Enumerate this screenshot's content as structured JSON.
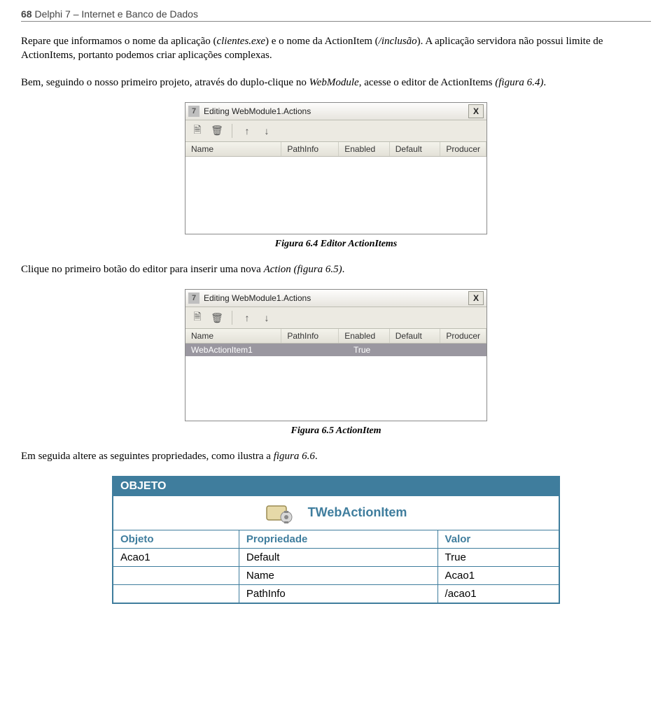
{
  "header": {
    "page_number": "68",
    "book_title": "Delphi 7 – Internet e Banco de Dados"
  },
  "para1_a": "Repare que informamos o nome da aplicação (",
  "para1_b": "clientes.exe",
  "para1_c": ") e o nome da ActionItem (",
  "para1_d": "/inclusão",
  "para1_e": "). A aplicação servidora não possui limite de ActionItems, portanto podemos criar aplicações complexas.",
  "para2_a": "Bem, seguindo o nosso primeiro projeto, através do duplo-clique no ",
  "para2_b": "WebModule",
  "para2_c": ", acesse o editor de ActionItems ",
  "para2_d": "(figura 6.4)",
  "para2_e": ".",
  "fig1": {
    "title": "Editing WebModule1.Actions",
    "columns": {
      "c1": "Name",
      "c2": "PathInfo",
      "c3": "Enabled",
      "c4": "Default",
      "c5": "Producer"
    },
    "caption": "Figura 6.4 Editor ActionItems"
  },
  "para3_a": "Clique no primeiro botão do editor para inserir uma nova ",
  "para3_b": "Action (figura 6.5)",
  "para3_c": ".",
  "fig2": {
    "title": "Editing WebModule1.Actions",
    "columns": {
      "c1": "Name",
      "c2": "PathInfo",
      "c3": "Enabled",
      "c4": "Default",
      "c5": "Producer"
    },
    "row": {
      "name": "WebActionItem1",
      "enabled": "True"
    },
    "caption": "Figura 6.5 ActionItem"
  },
  "para4_a": "Em seguida altere as seguintes propriedades, como ilustra a ",
  "para4_b": "figura 6.6",
  "para4_c": ".",
  "table": {
    "head": "OBJETO",
    "class_name": "TWebActionItem",
    "cols": {
      "c1": "Objeto",
      "c2": "Propriedade",
      "c3": "Valor"
    },
    "rows": [
      {
        "obj": "Acao1",
        "prop": "Default",
        "val": "True"
      },
      {
        "obj": "",
        "prop": "Name",
        "val": "Acao1"
      },
      {
        "obj": "",
        "prop": "PathInfo",
        "val": "/acao1"
      }
    ]
  },
  "icons": {
    "app": "7",
    "close": "X",
    "add": "🗎",
    "del": "🗑",
    "up": "↑",
    "down": "↓"
  }
}
